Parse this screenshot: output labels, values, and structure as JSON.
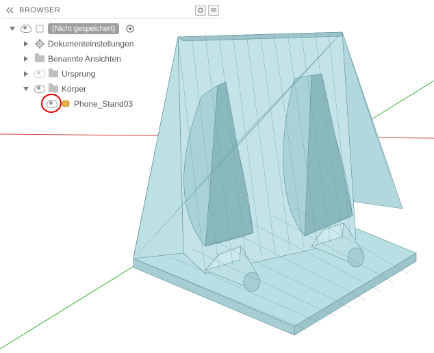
{
  "browser": {
    "title": "BROWSER",
    "root_label": "(Nicht gespeichert)",
    "items": {
      "settings": "Dokumenteinstellungen",
      "views": "Benannte Ansichten",
      "origin": "Ursprung",
      "bodies": "Körper",
      "body1": "Phone_Stand03"
    }
  },
  "colors": {
    "model_fill": "#b9dee3",
    "model_edge": "#5a8f96",
    "axis_x": "#d04040",
    "axis_y": "#3cae3c"
  }
}
